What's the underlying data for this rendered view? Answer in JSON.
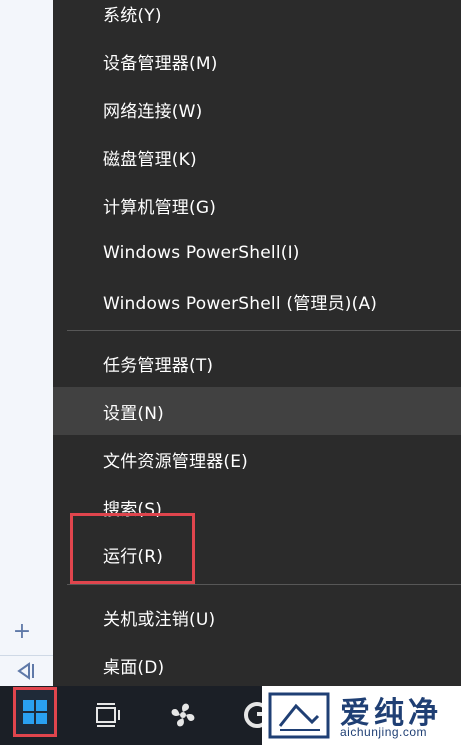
{
  "menu": {
    "items": [
      {
        "label": "系统(Y)"
      },
      {
        "label": "设备管理器(M)"
      },
      {
        "label": "网络连接(W)"
      },
      {
        "label": "磁盘管理(K)"
      },
      {
        "label": "计算机管理(G)"
      },
      {
        "label": "Windows PowerShell(I)"
      },
      {
        "label": "Windows PowerShell (管理员)(A)"
      },
      {
        "label": "任务管理器(T)"
      },
      {
        "label": "设置(N)"
      },
      {
        "label": "文件资源管理器(E)"
      },
      {
        "label": "搜索(S)"
      },
      {
        "label": "运行(R)"
      },
      {
        "label": "关机或注销(U)"
      },
      {
        "label": "桌面(D)"
      }
    ],
    "highlighted_item": "设置(N)",
    "boxed_item": "运行(R)"
  },
  "sidebar": {
    "plus_glyph": "+"
  },
  "watermark": {
    "title": "爱纯净",
    "url": "aichunjing.com"
  },
  "colors": {
    "menu_bg": "#2b2b2b",
    "highlight_bg": "#414141",
    "annotation_red": "#e0454d",
    "taskbar_bg": "#1b1f26",
    "windows_blue": "#2aa0f0",
    "watermark_blue": "#1f3f74"
  },
  "icons": [
    "plus-icon",
    "collapse-icon",
    "windows-start-icon",
    "task-view-icon",
    "fan-app-icon",
    "edge-browser-icon"
  ]
}
